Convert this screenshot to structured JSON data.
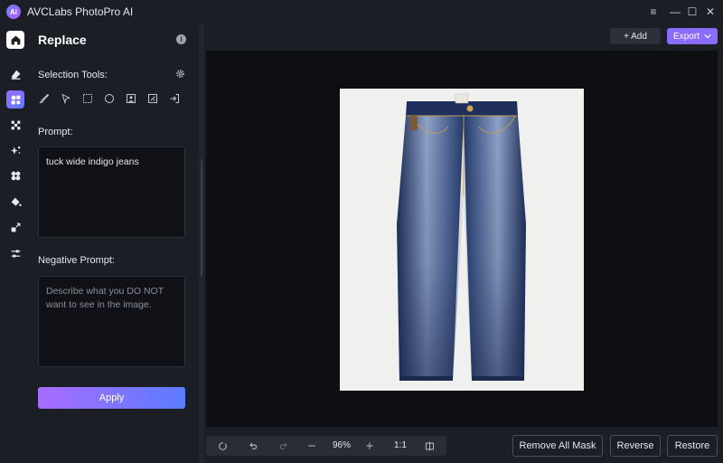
{
  "app": {
    "title": "AVCLabs PhotoPro AI",
    "logo_text": "Ai"
  },
  "window": {
    "menu": "≡",
    "minimize": "—",
    "maximize": "☐",
    "close": "✕"
  },
  "panel": {
    "title": "Replace",
    "selection_label": "Selection Tools:",
    "prompt_label": "Prompt:",
    "prompt_value": "tuck wide indigo jeans",
    "negative_label": "Negative Prompt:",
    "negative_placeholder": "Describe what you DO NOT want to see in the image.",
    "apply_label": "Apply"
  },
  "topbar": {
    "add_label": "+ Add",
    "export_label": "Export"
  },
  "bottombar": {
    "zoom_value": "96%",
    "ratio_label": "1:1",
    "remove_mask_label": "Remove All Mask",
    "reverse_label": "Reverse",
    "restore_label": "Restore"
  },
  "colors": {
    "accent": "#8a6cff",
    "background": "#1b1e25",
    "canvas": "#0d0f13"
  }
}
